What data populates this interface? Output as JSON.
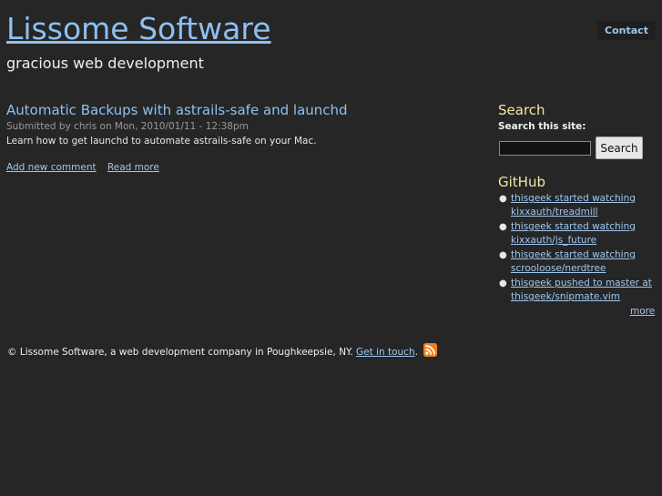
{
  "header": {
    "site_name": "Lissome Software",
    "slogan": "gracious web development",
    "contact_label": "Contact"
  },
  "node": {
    "title": "Automatic Backups with astrails-safe and launchd",
    "submitted": "Submitted by chris on Mon, 2010/01/11 - 12:38pm",
    "teaser": "Learn how to get launchd to automate astrails-safe on your Mac.",
    "links": {
      "add_comment": "Add new comment",
      "read_more": "Read more"
    }
  },
  "sidebar": {
    "search": {
      "title": "Search",
      "label": "Search this site:",
      "input_value": "",
      "button_label": "Search"
    },
    "github": {
      "title": "GitHub",
      "items": [
        {
          "line1": "thisgeek started watching",
          "line2": "kixxauth/treadmill"
        },
        {
          "line1": "thisgeek started watching",
          "line2": "kixxauth/js_future"
        },
        {
          "line1": "thisgeek started watching",
          "line2": "scrooloose/nerdtree"
        },
        {
          "line1": "thisgeek pushed to master at",
          "line2": "thisgeek/snipmate.vim"
        }
      ],
      "more_label": "more"
    }
  },
  "footer": {
    "text": "© Lissome Software, a web development company in Poughkeepsie, NY.",
    "link_label": "Get in touch",
    "after_link": ".",
    "rss_icon": "rss-feed-icon"
  },
  "colors": {
    "background": "#262626",
    "link": "#8ec0f0",
    "sidebar_heading": "#f3e6a0",
    "rss_orange": "#f0801a"
  }
}
